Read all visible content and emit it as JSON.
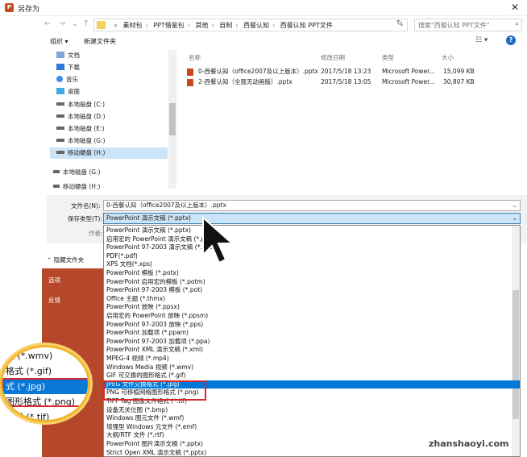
{
  "window": {
    "title": "另存为",
    "close_glyph": "✕"
  },
  "address": {
    "crumbs": [
      "素材包",
      "PPT借鉴包",
      "其他",
      "自制",
      "西餐认知",
      "西餐认知 PPT文件"
    ],
    "search_placeholder": "搜索\"西餐认知 PPT文件\""
  },
  "toolbar": {
    "organize": "组织 ▾",
    "new_folder": "新建文件夹"
  },
  "nav": {
    "items": [
      {
        "label": "文档",
        "icon": "document-icon"
      },
      {
        "label": "下载",
        "icon": "download-icon"
      },
      {
        "label": "音乐",
        "icon": "music-icon"
      },
      {
        "label": "桌面",
        "icon": "desktop-icon"
      },
      {
        "label": "本地磁盘 (C:)",
        "icon": "drive-icon"
      },
      {
        "label": "本地磁盘 (D:)",
        "icon": "drive-icon"
      },
      {
        "label": "本地磁盘 (E:)",
        "icon": "drive-icon"
      },
      {
        "label": "本地磁盘 (G:)",
        "icon": "drive-icon"
      },
      {
        "label": "移动硬盘 (H:)",
        "icon": "drive-icon"
      }
    ],
    "lower": [
      "本地磁盘 (G:)",
      "移动硬盘 (H:)"
    ]
  },
  "files": {
    "columns": [
      "名称",
      "修改日期",
      "类型",
      "大小"
    ],
    "rows": [
      {
        "name": "0-西餐认知（office2007及以上版本）.pptx",
        "date": "2017/5/18 13:23",
        "type": "Microsoft Power...",
        "size": "15,099 KB"
      },
      {
        "name": "2-西餐认知（全面无动画版）.pptx",
        "date": "2017/5/18 13:05",
        "type": "Microsoft Power...",
        "size": "30,807 KB"
      }
    ]
  },
  "form": {
    "filename_label": "文件名(N):",
    "filename_value": "0-西餐认知（office2007及以上版本）.pptx",
    "type_label": "保存类型(T):",
    "type_value": "PowerPoint 演示文稿 (*.pptx)",
    "author_label": "作者:",
    "hide_folders": "隐藏文件夹"
  },
  "side_panel": {
    "options": [
      "选项",
      "反馈"
    ]
  },
  "dropdown": {
    "selected_index": 18,
    "options": [
      "PowerPoint 演示文稿 (*.pptx)",
      "启用宏的 PowerPoint 演示文稿 (*.pptm)",
      "PowerPoint 97-2003 演示文稿 (*.ppt)",
      "PDF(*.pdf)",
      "XPS 文档(*.xps)",
      "PowerPoint 模板 (*.potx)",
      "PowerPoint 启用宏的模板 (*.potm)",
      "PowerPoint 97-2003 模板 (*.pot)",
      "Office 主题 (*.thmx)",
      "PowerPoint 放映 (*.ppsx)",
      "启用宏的 PowerPoint 放映 (*.ppsm)",
      "PowerPoint 97-2003 放映 (*.pps)",
      "PowerPoint 加载项 (*.ppam)",
      "PowerPoint 97-2003 加载项 (*.ppa)",
      "PowerPoint XML 演示文稿 (*.xml)",
      "MPEG-4 视频 (*.mp4)",
      "Windows Media 视频 (*.wmv)",
      "GIF 可交换的图形格式 (*.gif)",
      "JPEG 文件交换格式 (*.jpg)",
      "PNG 可移植网络图形格式 (*.png)",
      "TIFF Tag 图像文件格式 (*.tif)",
      "设备无关位图 (*.bmp)",
      "Windows 图元文件 (*.wmf)",
      "增强型 Windows 元文件 (*.emf)",
      "大纲/RTF 文件 (*.rtf)",
      "PowerPoint 图片演示文稿 (*.pptx)",
      "Strict Open XML 演示文稿 (*.pptx)"
    ]
  },
  "magnifier": {
    "lines": [
      "频 (*.wmv)",
      "格式 (*.gif)",
      "式 (*.jpg)",
      "图形格式 (*.png)",
      "格式 (*.tif)"
    ],
    "selected_index": 2
  },
  "watermark": "zhanshaoyi.com",
  "colors": {
    "accent": "#0078d7",
    "highlight_box": "#d9272e",
    "ppt_panel": "#b7472a",
    "magnifier_rim": "#f2b631"
  }
}
